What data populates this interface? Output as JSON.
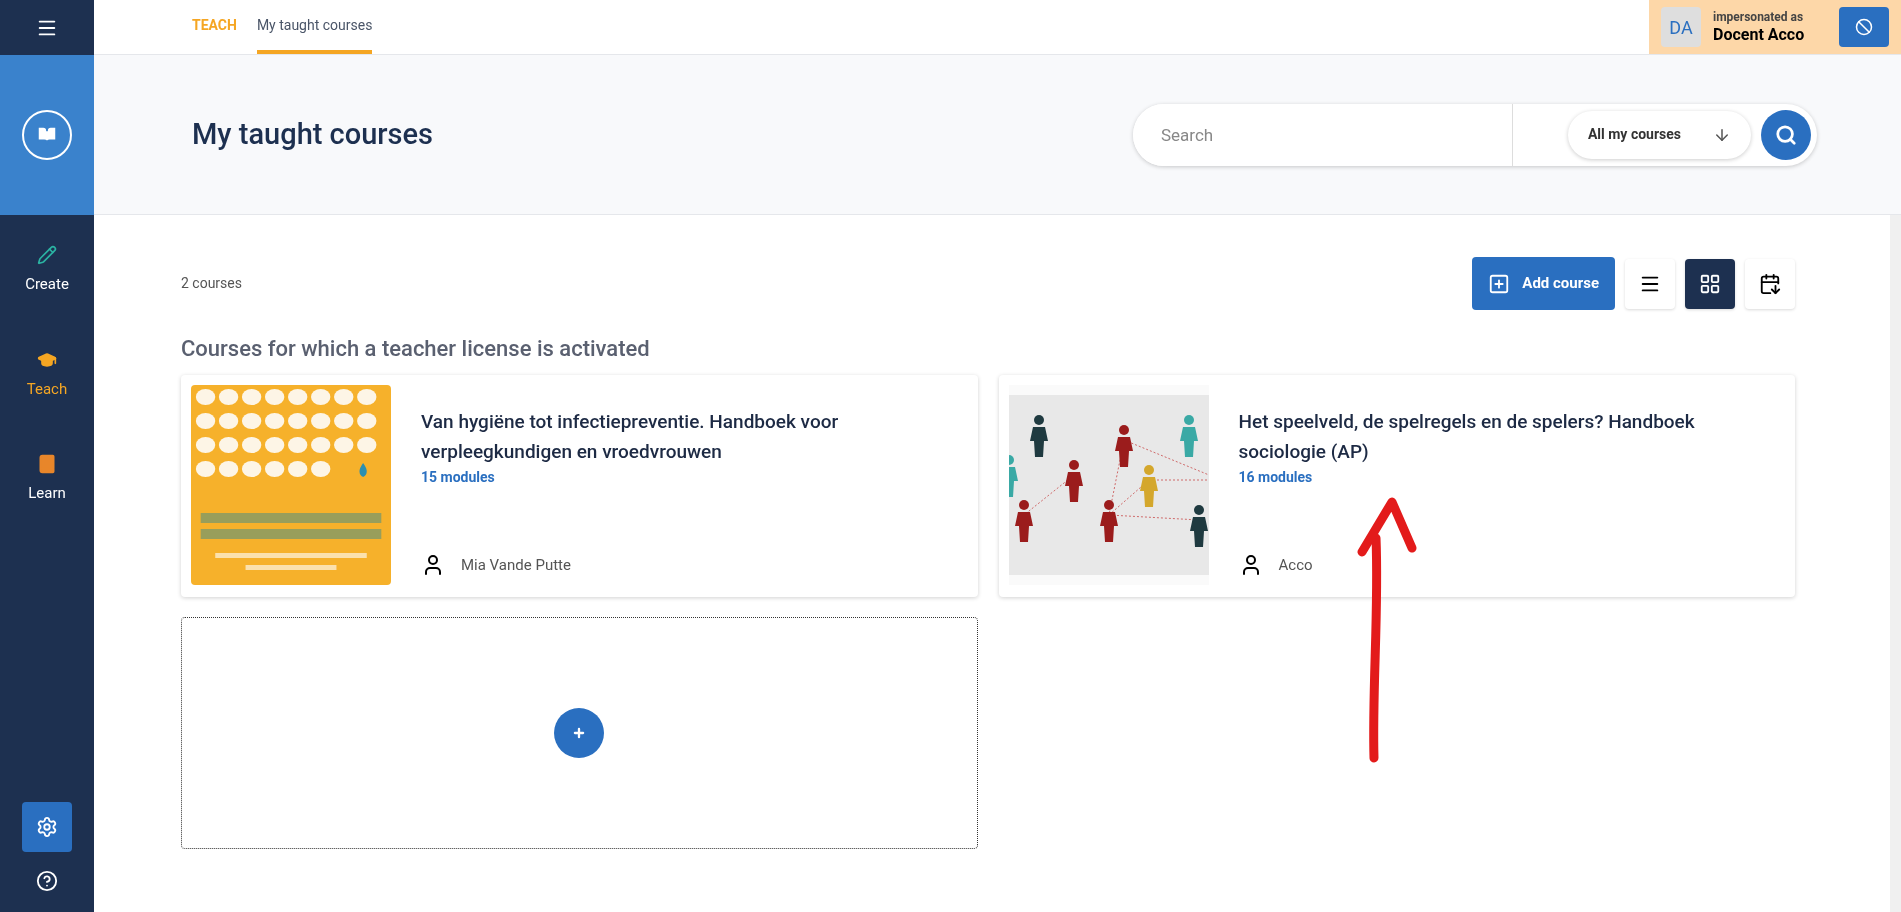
{
  "sidebar": {
    "items": [
      {
        "label": "Create",
        "kind": "create",
        "selected": false
      },
      {
        "label": "Teach",
        "kind": "teach",
        "selected": true
      },
      {
        "label": "Learn",
        "kind": "learn",
        "selected": false
      }
    ]
  },
  "breadcrumb": [
    {
      "label": "TEACH",
      "selected": false
    },
    {
      "label": "My taught courses",
      "selected": true
    }
  ],
  "impersonation": {
    "initials": "DA",
    "caption": "impersonated as",
    "name": "Docent Acco"
  },
  "header": {
    "title": "My taught courses",
    "search": {
      "placeholder": "Search"
    },
    "filter": "All my courses"
  },
  "toolbar": {
    "count": "2 courses",
    "add_button": "Add course",
    "views": [
      {
        "kind": "list",
        "selected": false
      },
      {
        "kind": "grid",
        "selected": true
      },
      {
        "kind": "sort",
        "selected": false
      }
    ]
  },
  "section_title": "Courses for which a teacher license is activated",
  "courses": [
    {
      "title": "Van hygiëne tot infectiepreventie. Handboek voor verpleegkundigen en vroedvrouwen",
      "modules": "15 modules",
      "author": "Mia Vande Putte"
    },
    {
      "title": "Het speelveld, de spelregels en de spelers? Handboek sociologie (AP)",
      "modules": "16 modules",
      "author": "Acco"
    }
  ]
}
